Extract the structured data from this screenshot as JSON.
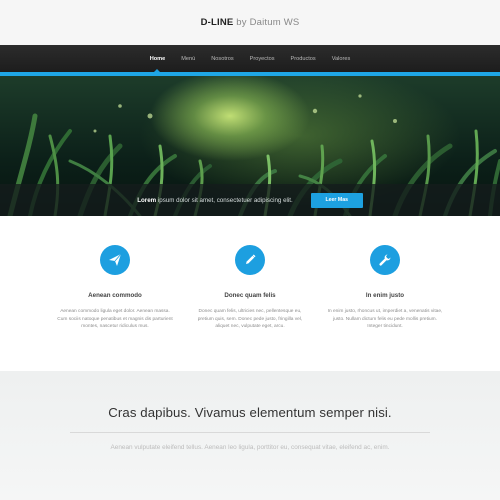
{
  "header": {
    "brand": "D-LINE",
    "brand_suffix": "by Daitum WS"
  },
  "nav": {
    "items": [
      "Home",
      "Menú",
      "Nosotros",
      "Proyectos",
      "Productos",
      "Valores"
    ],
    "active": "Home",
    "accent_color": "#1fa7e6"
  },
  "hero": {
    "lead_bold": "Lorem",
    "lead_text": "ipsum dolor sit amet, consectetuer adipiscing elit.",
    "button_label": "Leer Mas"
  },
  "features": [
    {
      "icon": "paper-plane-icon",
      "title": "Aenean commodo",
      "text": "Aenean commodo ligula eget dolor. Aenean massa. Cum sociis natoque penatibus et magnis dis parturient montes, nascetur ridiculus mus."
    },
    {
      "icon": "pencil-icon",
      "title": "Donec quam felis",
      "text": "Donec quam felis, ultricies nec, pellentesque eu, pretium quis, sem. Donec pede justo, fringilla vel, aliquet nec, vulputate eget, arcu."
    },
    {
      "icon": "wrench-icon",
      "title": "In enim justo",
      "text": "In enim justo, rhoncus ut, imperdiet a, venenatis vitae, justo. Nullam dictum felis eu pede mollis pretium. Integer tincidunt."
    }
  ],
  "bottom": {
    "heading": "Cras dapibus. Vivamus elementum semper nisi.",
    "subtext": "Aenean vulputate eleifend tellus. Aenean leo ligula, porttitor eu, consequat vitae, eleifend ac, enim."
  }
}
